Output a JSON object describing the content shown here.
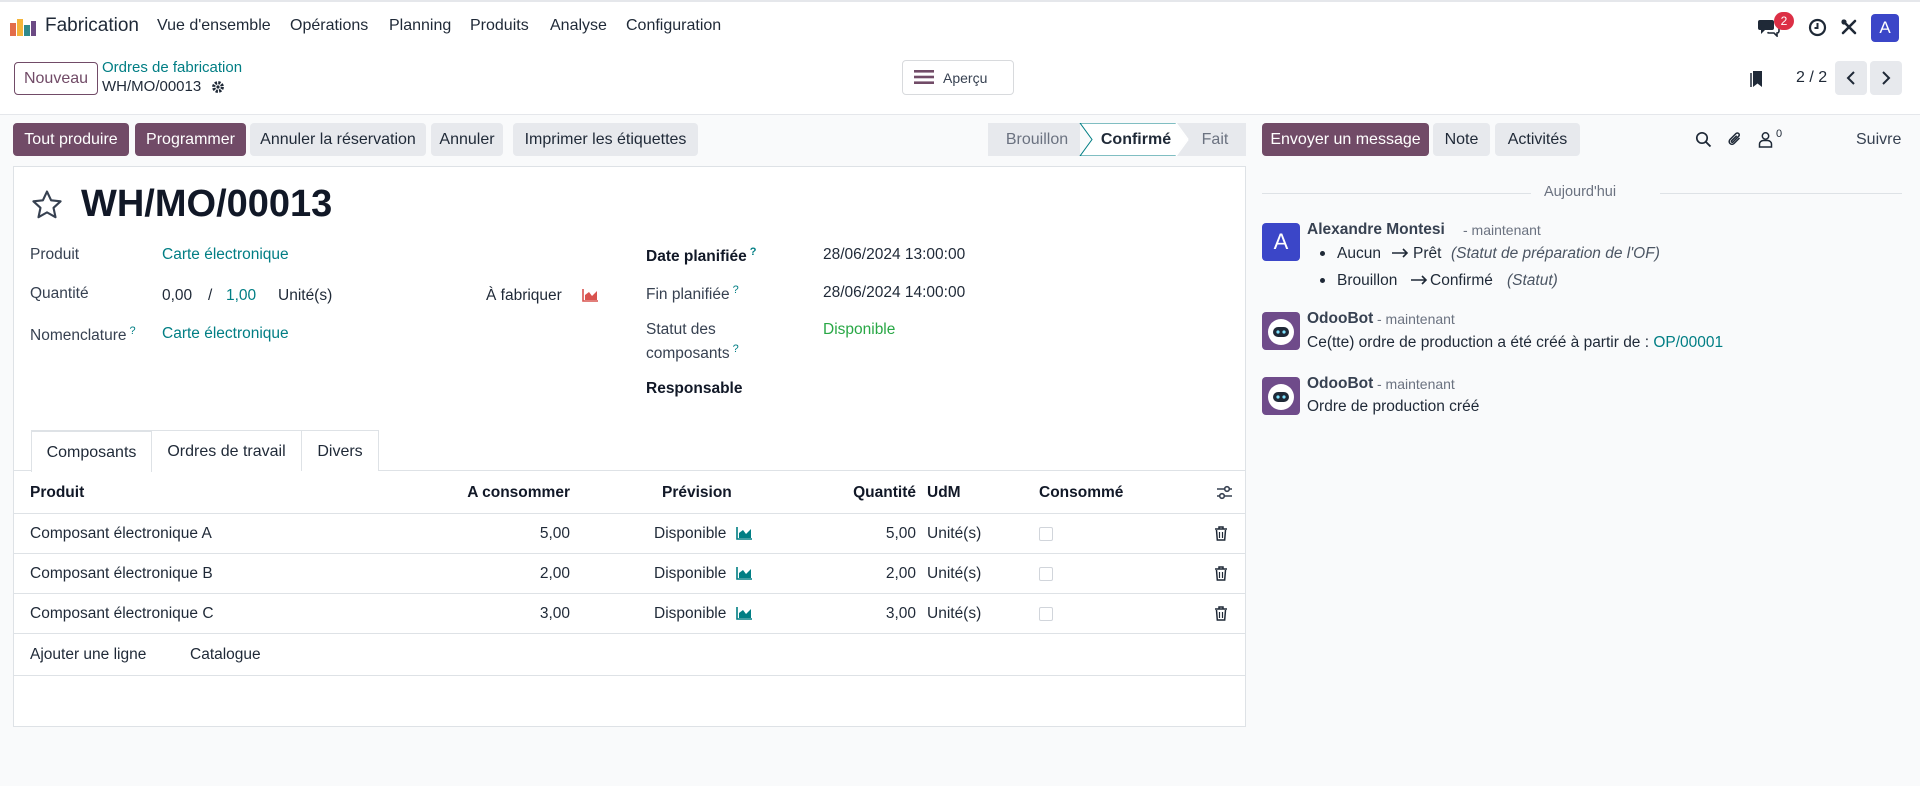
{
  "navbar": {
    "app_name": "Fabrication",
    "menu": [
      "Vue d'ensemble",
      "Opérations",
      "Planning",
      "Produits",
      "Analyse",
      "Configuration"
    ],
    "message_count": "2",
    "user_initial": "A"
  },
  "control_panel": {
    "new_label": "Nouveau",
    "breadcrumb_parent": "Ordres de fabrication",
    "breadcrumb_current": "WH/MO/00013",
    "apercu_label": "Aperçu",
    "pager": "2 / 2"
  },
  "actions": {
    "produce_all": "Tout produire",
    "schedule": "Programmer",
    "unreserve": "Annuler la réservation",
    "cancel": "Annuler",
    "print_labels": "Imprimer les étiquettes"
  },
  "statusbar": {
    "stages": [
      "Brouillon",
      "Confirmé",
      "Fait"
    ],
    "current": "Confirmé"
  },
  "form": {
    "title": "WH/MO/00013",
    "product_label": "Produit",
    "product_value": "Carte électronique",
    "quantity_label": "Quantité",
    "qty_produced": "0,00",
    "qty_separator": "/",
    "qty_total": "1,00",
    "uom": "Unité(s)",
    "to_produce_label": "À fabriquer",
    "bom_label": "Nomenclature",
    "bom_help": "?",
    "bom_value": "Carte électronique",
    "date_planned_label": "Date planifiée",
    "date_planned_help": "?",
    "date_planned_value": "28/06/2024 13:00:00",
    "date_end_label": "Fin planifiée",
    "date_end_help": "?",
    "date_end_value": "28/06/2024 14:00:00",
    "components_status_label_1": "Statut des",
    "components_status_label_2": "composants",
    "components_status_help": "?",
    "components_status_value": "Disponible",
    "responsible_label": "Responsable"
  },
  "tabs": [
    "Composants",
    "Ordres de travail",
    "Divers"
  ],
  "table": {
    "headers": {
      "product": "Produit",
      "to_consume": "A consommer",
      "forecast": "Prévision",
      "quantity": "Quantité",
      "uom": "UdM",
      "consumed": "Consommé"
    },
    "rows": [
      {
        "product": "Composant électronique A",
        "to_consume": "5,00",
        "forecast": "Disponible",
        "quantity": "5,00",
        "uom": "Unité(s)"
      },
      {
        "product": "Composant électronique B",
        "to_consume": "2,00",
        "forecast": "Disponible",
        "quantity": "2,00",
        "uom": "Unité(s)"
      },
      {
        "product": "Composant électronique C",
        "to_consume": "3,00",
        "forecast": "Disponible",
        "quantity": "3,00",
        "uom": "Unité(s)"
      }
    ],
    "add_line": "Ajouter une ligne",
    "catalog": "Catalogue"
  },
  "chatter": {
    "send_message": "Envoyer un message",
    "note": "Note",
    "activities": "Activités",
    "followers_count": "0",
    "follow": "Suivre",
    "today": "Aujourd'hui",
    "messages": [
      {
        "author": "Alexandre Montesi",
        "meta": "- maintenant",
        "avatar": "A",
        "changes": [
          {
            "old": "Aucun",
            "new": "Prêt",
            "field": "(Statut de préparation de l'OF)"
          },
          {
            "old": "Brouillon",
            "new": "Confirmé",
            "field": "(Statut)"
          }
        ]
      },
      {
        "author": "OdooBot",
        "meta": "- maintenant",
        "text": "Ce(tte) ordre de production a été créé à partir de :",
        "link": "OP/00001"
      },
      {
        "author": "OdooBot",
        "meta": "- maintenant",
        "text": "Ordre de production créé"
      }
    ]
  },
  "colors": {
    "primary": "#714b67",
    "link": "#017e84",
    "success": "#28a745",
    "badge": "#dc2f45",
    "avatar": "#3b46c8"
  },
  "icons": [
    "app-icon",
    "gear-icon",
    "hamburger-icon",
    "bookmark-icon",
    "chevron-left-icon",
    "chevron-right-icon",
    "star-icon",
    "area-chart-icon",
    "trash-icon",
    "sliders-icon",
    "search-icon",
    "paperclip-icon",
    "user-icon",
    "chat-icon",
    "clock-icon",
    "tools-icon",
    "robot-icon"
  ]
}
